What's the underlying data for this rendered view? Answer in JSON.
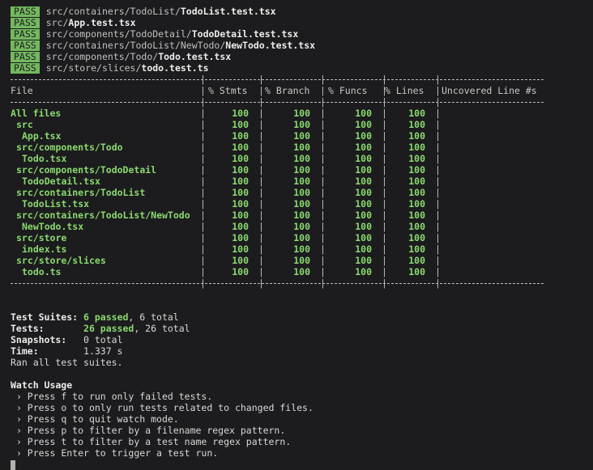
{
  "passes": [
    {
      "badge": "PASS",
      "dir": "src/containers/TodoList/",
      "file": "TodoList.test.tsx"
    },
    {
      "badge": "PASS",
      "dir": "src/",
      "file": "App.test.tsx"
    },
    {
      "badge": "PASS",
      "dir": "src/components/TodoDetail/",
      "file": "TodoDetail.test.tsx"
    },
    {
      "badge": "PASS",
      "dir": "src/containers/TodoList/NewTodo/",
      "file": "NewTodo.test.tsx"
    },
    {
      "badge": "PASS",
      "dir": "src/components/Todo/",
      "file": "Todo.test.tsx"
    },
    {
      "badge": "PASS",
      "dir": "src/store/slices/",
      "file": "todo.test.ts"
    }
  ],
  "table": {
    "headers": [
      "File",
      "% Stmts",
      "% Branch",
      "% Funcs",
      "% Lines",
      "Uncovered Line #s"
    ],
    "rows": [
      {
        "file": "All files",
        "indent": 0,
        "stmts": "100",
        "branch": "100",
        "funcs": "100",
        "lines": "100",
        "uncovered": ""
      },
      {
        "file": "src",
        "indent": 1,
        "stmts": "100",
        "branch": "100",
        "funcs": "100",
        "lines": "100",
        "uncovered": ""
      },
      {
        "file": "App.tsx",
        "indent": 2,
        "stmts": "100",
        "branch": "100",
        "funcs": "100",
        "lines": "100",
        "uncovered": ""
      },
      {
        "file": "src/components/Todo",
        "indent": 1,
        "stmts": "100",
        "branch": "100",
        "funcs": "100",
        "lines": "100",
        "uncovered": ""
      },
      {
        "file": "Todo.tsx",
        "indent": 2,
        "stmts": "100",
        "branch": "100",
        "funcs": "100",
        "lines": "100",
        "uncovered": ""
      },
      {
        "file": "src/components/TodoDetail",
        "indent": 1,
        "stmts": "100",
        "branch": "100",
        "funcs": "100",
        "lines": "100",
        "uncovered": ""
      },
      {
        "file": "TodoDetail.tsx",
        "indent": 2,
        "stmts": "100",
        "branch": "100",
        "funcs": "100",
        "lines": "100",
        "uncovered": ""
      },
      {
        "file": "src/containers/TodoList",
        "indent": 1,
        "stmts": "100",
        "branch": "100",
        "funcs": "100",
        "lines": "100",
        "uncovered": ""
      },
      {
        "file": "TodoList.tsx",
        "indent": 2,
        "stmts": "100",
        "branch": "100",
        "funcs": "100",
        "lines": "100",
        "uncovered": ""
      },
      {
        "file": "src/containers/TodoList/NewTodo",
        "indent": 1,
        "stmts": "100",
        "branch": "100",
        "funcs": "100",
        "lines": "100",
        "uncovered": ""
      },
      {
        "file": "NewTodo.tsx",
        "indent": 2,
        "stmts": "100",
        "branch": "100",
        "funcs": "100",
        "lines": "100",
        "uncovered": ""
      },
      {
        "file": "src/store",
        "indent": 1,
        "stmts": "100",
        "branch": "100",
        "funcs": "100",
        "lines": "100",
        "uncovered": ""
      },
      {
        "file": "index.ts",
        "indent": 2,
        "stmts": "100",
        "branch": "100",
        "funcs": "100",
        "lines": "100",
        "uncovered": ""
      },
      {
        "file": "src/store/slices",
        "indent": 1,
        "stmts": "100",
        "branch": "100",
        "funcs": "100",
        "lines": "100",
        "uncovered": ""
      },
      {
        "file": "todo.ts",
        "indent": 2,
        "stmts": "100",
        "branch": "100",
        "funcs": "100",
        "lines": "100",
        "uncovered": ""
      }
    ]
  },
  "summary": {
    "suites_label": "Test Suites:",
    "suites_passed": "6 passed",
    "suites_total": ", 6 total",
    "tests_label": "Tests:",
    "tests_passed": "26 passed",
    "tests_total": ", 26 total",
    "snapshots_label": "Snapshots:",
    "snapshots_value": "0 total",
    "time_label": "Time:",
    "time_value": "1.337 s",
    "ran": "Ran all test suites."
  },
  "watch": {
    "title": "Watch Usage",
    "items": [
      "› Press f to run only failed tests.",
      "› Press o to only run tests related to changed files.",
      "› Press q to quit watch mode.",
      "› Press p to filter by a filename regex pattern.",
      "› Press t to filter by a test name regex pattern.",
      "› Press Enter to trigger a test run."
    ]
  },
  "colors": {
    "background": "#1c1c1e",
    "pass_badge": "#74b85f",
    "coverage_green": "#8ad86e",
    "text": "#c8c8c8"
  }
}
